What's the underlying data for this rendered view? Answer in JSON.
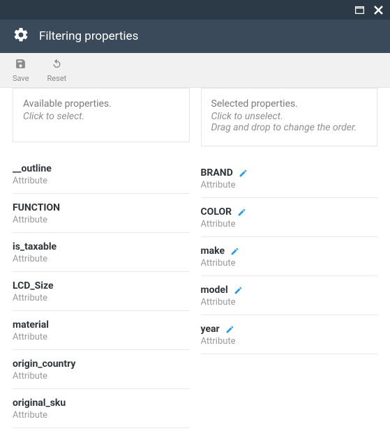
{
  "window": {
    "title": "Filtering properties"
  },
  "toolbar": {
    "save_label": "Save",
    "reset_label": "Reset"
  },
  "available": {
    "header_line1": "Available properties.",
    "header_line2": "Click to select.",
    "items": [
      {
        "label": "__outline",
        "type": "Attribute"
      },
      {
        "label": "FUNCTION",
        "type": "Attribute"
      },
      {
        "label": "is_taxable",
        "type": "Attribute"
      },
      {
        "label": "LCD_Size",
        "type": "Attribute"
      },
      {
        "label": "material",
        "type": "Attribute"
      },
      {
        "label": "origin_country",
        "type": "Attribute"
      },
      {
        "label": "original_sku",
        "type": "Attribute"
      }
    ]
  },
  "selected": {
    "header_line1": "Selected properties.",
    "header_line2": "Click to unselect.",
    "header_line3": "Drag and drop to change the order.",
    "items": [
      {
        "label": "BRAND",
        "type": "Attribute"
      },
      {
        "label": "COLOR",
        "type": "Attribute"
      },
      {
        "label": "make",
        "type": "Attribute"
      },
      {
        "label": "model",
        "type": "Attribute"
      },
      {
        "label": "year",
        "type": "Attribute"
      }
    ]
  }
}
